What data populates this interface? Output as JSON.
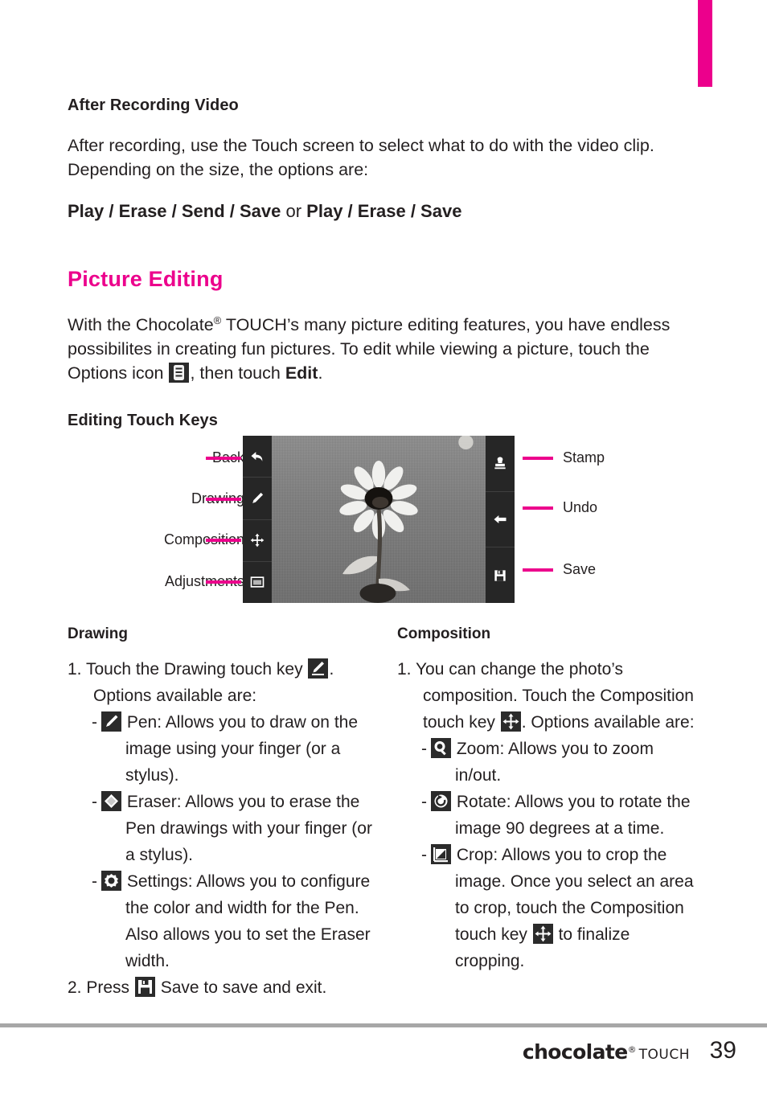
{
  "page": {
    "number": "39",
    "brand_name": "chocolate",
    "brand_reg": "®",
    "brand_sub": "TOUCH"
  },
  "section_after_recording": {
    "heading": "After Recording Video",
    "paragraph": "After recording, use the Touch screen to select what to do with the video clip. Depending on the size, the options are:",
    "options_bold_1": "Play / Erase / Send / Save",
    "options_conjunction": " or ",
    "options_bold_2": "Play / Erase / Save"
  },
  "section_picture_editing": {
    "heading": "Picture Editing",
    "heading_color": "#ec008c",
    "paragraph_part1": "With the Chocolate",
    "paragraph_reg": "®",
    "paragraph_part2": " TOUCH’s many picture editing features, you have endless possibilites in creating fun pictures. To edit while viewing a picture, touch the Options icon ",
    "options_icon": "options-list-icon",
    "paragraph_part3": ", then touch ",
    "edit_bold": "Edit",
    "paragraph_end": "."
  },
  "diagram": {
    "heading": "Editing Touch Keys",
    "left_labels": [
      {
        "label": "Back",
        "icon": "back-arrow-icon"
      },
      {
        "label": "Drawing",
        "icon": "pen-icon"
      },
      {
        "label": "Composition",
        "icon": "move-arrows-icon"
      },
      {
        "label": "Adjustments",
        "icon": "adjustments-icon"
      }
    ],
    "right_labels": [
      {
        "label": "Stamp",
        "icon": "stamp-icon"
      },
      {
        "label": "Undo",
        "icon": "undo-arrow-icon"
      },
      {
        "label": "Save",
        "icon": "floppy-save-icon"
      }
    ],
    "screen_content": "grayscale photo of a sunflower against a textured wall"
  },
  "drawing_column": {
    "heading": "Drawing",
    "step1_a": "1. Touch the Drawing touch key ",
    "step1_icon": "drawing-key-icon",
    "step1_b": ". Options available are:",
    "items": [
      {
        "dash": "-",
        "icon": "pen-icon",
        "text": "Pen: Allows you to draw on the image using your finger (or a stylus)."
      },
      {
        "dash": "-",
        "icon": "eraser-icon",
        "text": "Eraser: Allows you to erase the Pen drawings with your finger (or a stylus)."
      },
      {
        "dash": "-",
        "icon": "settings-gear-icon",
        "text": "Settings: Allows you to configure the color and width for the Pen. Also allows you to set the Eraser width."
      }
    ],
    "step2_a": "2. Press ",
    "step2_icon": "floppy-save-icon",
    "step2_b": " Save to save and exit."
  },
  "composition_column": {
    "heading": "Composition",
    "step1_a": "1. You can change the photo’s composition. Touch the Composition touch key ",
    "step1_icon": "move-arrows-icon",
    "step1_b": ". Options available are:",
    "items": [
      {
        "dash": "-",
        "icon": "zoom-magnifier-icon",
        "text": "Zoom: Allows you to zoom in/out."
      },
      {
        "dash": "-",
        "icon": "rotate-icon",
        "text": "Rotate: Allows you to rotate the image 90 degrees at a time."
      },
      {
        "dash": "-",
        "icon": "crop-icon",
        "text_a": "Crop: Allows you to crop the image. Once you select an area to crop, touch the Composition touch key ",
        "icon_inline": "move-arrows-icon",
        "text_b": " to finalize cropping."
      }
    ]
  }
}
